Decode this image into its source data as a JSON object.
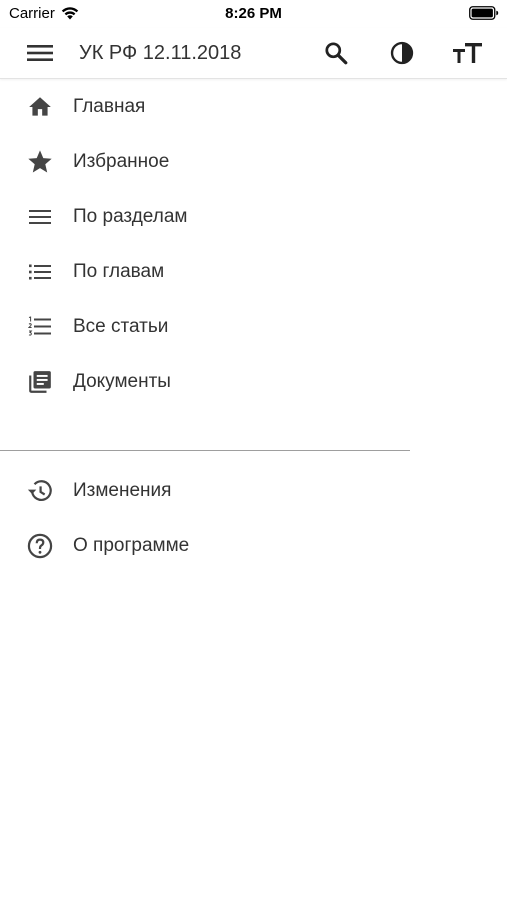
{
  "status_bar": {
    "carrier": "Carrier",
    "time": "8:26 PM"
  },
  "app_bar": {
    "title": "УК РФ 12.11.2018",
    "icons": {
      "menu": "menu-icon",
      "search": "search-icon",
      "contrast": "contrast-icon",
      "text_size": "text-size-icon"
    }
  },
  "drawer": {
    "primary_items": [
      {
        "label": "Главная",
        "icon": "home-icon"
      },
      {
        "label": "Избранное",
        "icon": "star-icon"
      },
      {
        "label": "По разделам",
        "icon": "sections-icon"
      },
      {
        "label": "По главам",
        "icon": "chapters-list-icon"
      },
      {
        "label": "Все статьи",
        "icon": "numbered-list-icon"
      },
      {
        "label": "Документы",
        "icon": "documents-icon"
      }
    ],
    "secondary_items": [
      {
        "label": "Изменения",
        "icon": "history-icon"
      },
      {
        "label": "О программе",
        "icon": "help-icon"
      }
    ]
  },
  "colors": {
    "icon": "#454545",
    "text": "#333333",
    "divider": "#9e9e9e",
    "background": "#ffffff"
  }
}
